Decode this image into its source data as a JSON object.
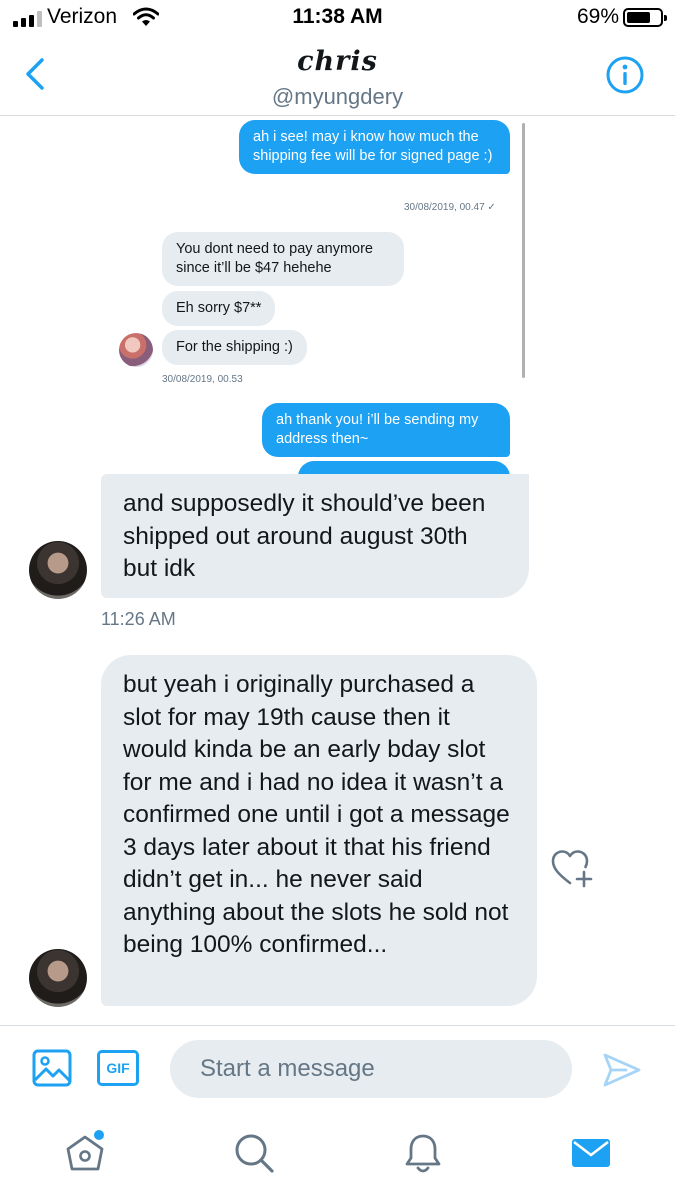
{
  "status_bar": {
    "carrier": "Verizon",
    "time": "11:38 AM",
    "battery_percent": "69%",
    "battery_level": 0.69
  },
  "header": {
    "name": "chris",
    "handle": "@myungdery"
  },
  "embedded_screenshot": {
    "messages": [
      {
        "direction": "out",
        "text": "ah i see! may i know how much the shipping fee will be for signed page :)"
      },
      {
        "direction": "meta",
        "text": "30/08/2019, 00.47 ✓"
      },
      {
        "direction": "in",
        "text": "You dont need to pay anymore since it’ll be $47 hehehe"
      },
      {
        "direction": "in",
        "text": "Eh sorry $7**"
      },
      {
        "direction": "in",
        "text": "For the shipping :)"
      },
      {
        "direction": "meta",
        "text": "30/08/2019, 00.53"
      },
      {
        "direction": "out",
        "text": "ah thank you! i’ll be sending my address then~"
      }
    ]
  },
  "messages": [
    {
      "direction": "in",
      "text": "and supposedly it should’ve been shipped out around august 30th but idk",
      "timestamp": "11:26 AM"
    },
    {
      "direction": "in",
      "text": "but yeah i originally purchased a slot for may 19th cause then it would kinda be an early bday slot for me and i had no idea it wasn’t a confirmed one until i got a message 3 days later about it that his friend didn’t get in... he never said anything about the slots he sold not being 100% confirmed..."
    }
  ],
  "composer": {
    "placeholder": "Start a message",
    "gif_label": "GIF"
  },
  "colors": {
    "accent": "#1da1f2",
    "bubble_in": "#e6ecf0",
    "secondary_text": "#657786"
  }
}
